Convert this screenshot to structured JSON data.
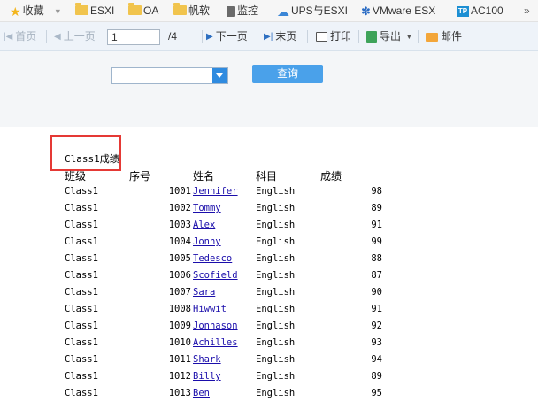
{
  "bookmarks_bar": {
    "items": [
      {
        "label": "收藏",
        "icon": "star-icon"
      },
      {
        "label": "ESXI",
        "icon": "folder-icon"
      },
      {
        "label": "OA",
        "icon": "folder-icon"
      },
      {
        "label": "帆软",
        "icon": "folder-icon"
      },
      {
        "label": "监控",
        "icon": "page-icon"
      },
      {
        "label": "UPS与ESXI",
        "icon": "cloud-icon"
      },
      {
        "label": "VMware ESX",
        "icon": "paw-icon"
      },
      {
        "label": "AC100",
        "icon": "tp-link-icon"
      }
    ],
    "tp_logo_text": "TP",
    "more_glyph": "»"
  },
  "toolbar": {
    "first_page": "首页",
    "prev_page": "上一页",
    "page_current": "1",
    "page_total": "/4",
    "next_page": "下一页",
    "last_page": "末页",
    "print": "打印",
    "export": "导出",
    "mail": "邮件"
  },
  "query_panel": {
    "dropdown_value": "",
    "query_button": "查询"
  },
  "report": {
    "title": "Class1成绩",
    "columns": [
      "班级",
      "序号",
      "姓名",
      "科目",
      "成绩"
    ],
    "rows": [
      [
        "Class1",
        "1001",
        "Jennifer",
        "English",
        "98"
      ],
      [
        "Class1",
        "1002",
        "Tommy",
        "English",
        "89"
      ],
      [
        "Class1",
        "1003",
        "Alex",
        "English",
        "91"
      ],
      [
        "Class1",
        "1004",
        "Jonny",
        "English",
        "99"
      ],
      [
        "Class1",
        "1005",
        "Tedesco",
        "English",
        "88"
      ],
      [
        "Class1",
        "1006",
        "Scofield",
        "English",
        "87"
      ],
      [
        "Class1",
        "1007",
        "Sara",
        "English",
        "90"
      ],
      [
        "Class1",
        "1008",
        "Hiwwit",
        "English",
        "91"
      ],
      [
        "Class1",
        "1009",
        "Jonnason",
        "English",
        "92"
      ],
      [
        "Class1",
        "1010",
        "Achilles",
        "English",
        "93"
      ],
      [
        "Class1",
        "1011",
        "Shark",
        "English",
        "94"
      ],
      [
        "Class1",
        "1012",
        "Billy",
        "English",
        "89"
      ],
      [
        "Class1",
        "1013",
        "Ben",
        "English",
        "95"
      ]
    ]
  },
  "colors": {
    "accent_blue": "#2f8be0",
    "query_button": "#4aa1ea",
    "highlight_red": "#e53935",
    "link_blue": "#1a0dab"
  }
}
